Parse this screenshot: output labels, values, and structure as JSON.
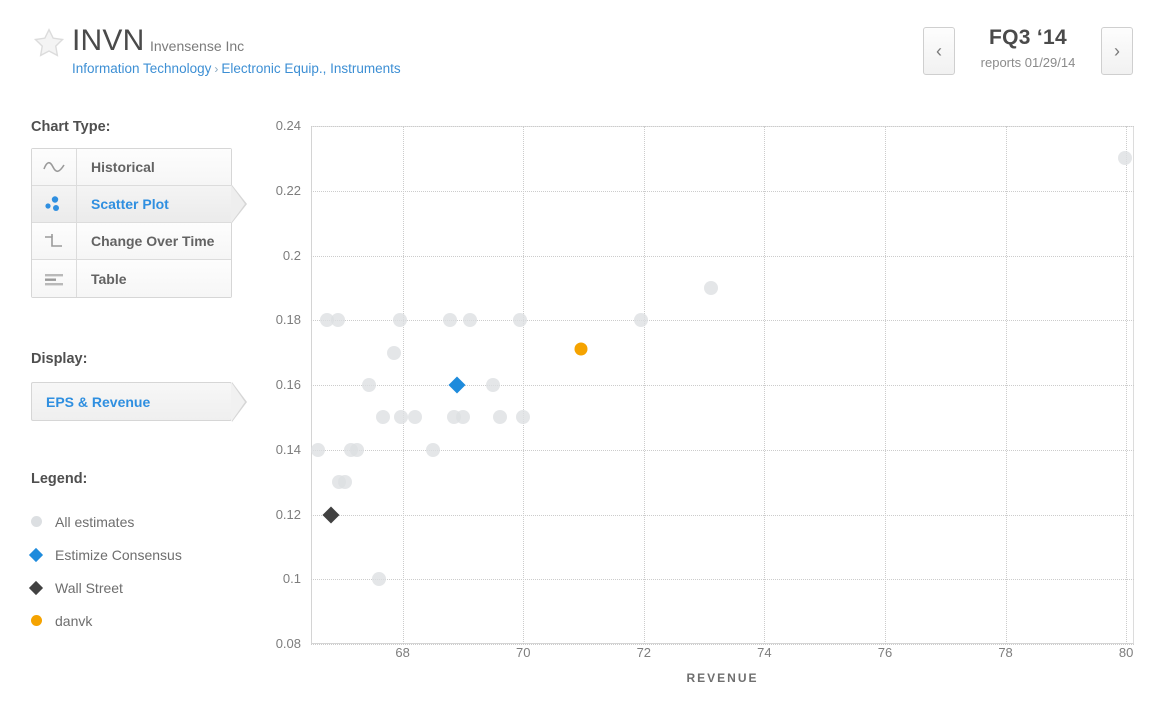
{
  "header": {
    "star_icon": "star-icon",
    "ticker": "INVN",
    "company": "Invensense Inc",
    "breadcrumb_sector": "Information Technology",
    "breadcrumb_sep": "›",
    "breadcrumb_industry": "Electronic Equip., Instruments",
    "prev_label": "‹",
    "next_label": "›",
    "period": "FQ3 ‘14",
    "period_sub": "reports 01/29/14"
  },
  "sidebar": {
    "chart_type_heading": "Chart Type:",
    "chart_types": [
      {
        "label": "Historical",
        "icon": "wave-icon",
        "selected": false
      },
      {
        "label": "Scatter Plot",
        "icon": "scatter-icon",
        "selected": true
      },
      {
        "label": "Change Over Time",
        "icon": "step-icon",
        "selected": false
      },
      {
        "label": "Table",
        "icon": "table-icon",
        "selected": false
      }
    ],
    "display_heading": "Display:",
    "display_value": "EPS & Revenue",
    "legend_heading": "Legend:",
    "legend": [
      {
        "label": "All estimates",
        "marker": "dot",
        "color": "#dcdfe2"
      },
      {
        "label": "Estimize Consensus",
        "marker": "diamond",
        "color": "#1e8bdc"
      },
      {
        "label": "Wall Street",
        "marker": "diamond",
        "color": "#414141"
      },
      {
        "label": "danvk",
        "marker": "dot",
        "color": "#f5a300"
      }
    ]
  },
  "chart_data": {
    "type": "scatter",
    "title": "",
    "xlabel": "REVENUE",
    "ylabel": "",
    "xlim": [
      66.48,
      80.13
    ],
    "ylim": [
      0.08,
      0.24
    ],
    "xticks": [
      68,
      70,
      72,
      74,
      76,
      78,
      80
    ],
    "yticks": [
      0.08,
      0.1,
      0.12,
      0.14,
      0.16,
      0.18,
      0.2,
      0.22,
      0.24
    ],
    "grid": true,
    "legend_position": "external-left",
    "series": [
      {
        "name": "All estimates",
        "marker": "dot",
        "color": "#dcdfe2",
        "points": [
          [
            66.6,
            0.14
          ],
          [
            66.75,
            0.18
          ],
          [
            66.92,
            0.18
          ],
          [
            66.95,
            0.13
          ],
          [
            67.05,
            0.13
          ],
          [
            67.15,
            0.14
          ],
          [
            67.25,
            0.14
          ],
          [
            67.45,
            0.16
          ],
          [
            67.6,
            0.1
          ],
          [
            67.68,
            0.15
          ],
          [
            67.86,
            0.17
          ],
          [
            67.96,
            0.18
          ],
          [
            67.98,
            0.15
          ],
          [
            68.2,
            0.15
          ],
          [
            68.5,
            0.14
          ],
          [
            68.78,
            0.18
          ],
          [
            68.86,
            0.15
          ],
          [
            69.0,
            0.15
          ],
          [
            69.12,
            0.18
          ],
          [
            69.5,
            0.16
          ],
          [
            69.62,
            0.15
          ],
          [
            69.95,
            0.18
          ],
          [
            70.0,
            0.15
          ],
          [
            71.95,
            0.18
          ],
          [
            73.12,
            0.19
          ],
          [
            79.98,
            0.23
          ]
        ]
      },
      {
        "name": "Estimize Consensus",
        "marker": "diamond",
        "color": "#1e8bdc",
        "points": [
          [
            68.9,
            0.16
          ]
        ]
      },
      {
        "name": "Wall Street",
        "marker": "diamond",
        "color": "#414141",
        "points": [
          [
            66.82,
            0.12
          ]
        ]
      },
      {
        "name": "danvk",
        "marker": "dot",
        "color": "#f5a300",
        "points": [
          [
            70.95,
            0.171
          ]
        ]
      }
    ]
  }
}
